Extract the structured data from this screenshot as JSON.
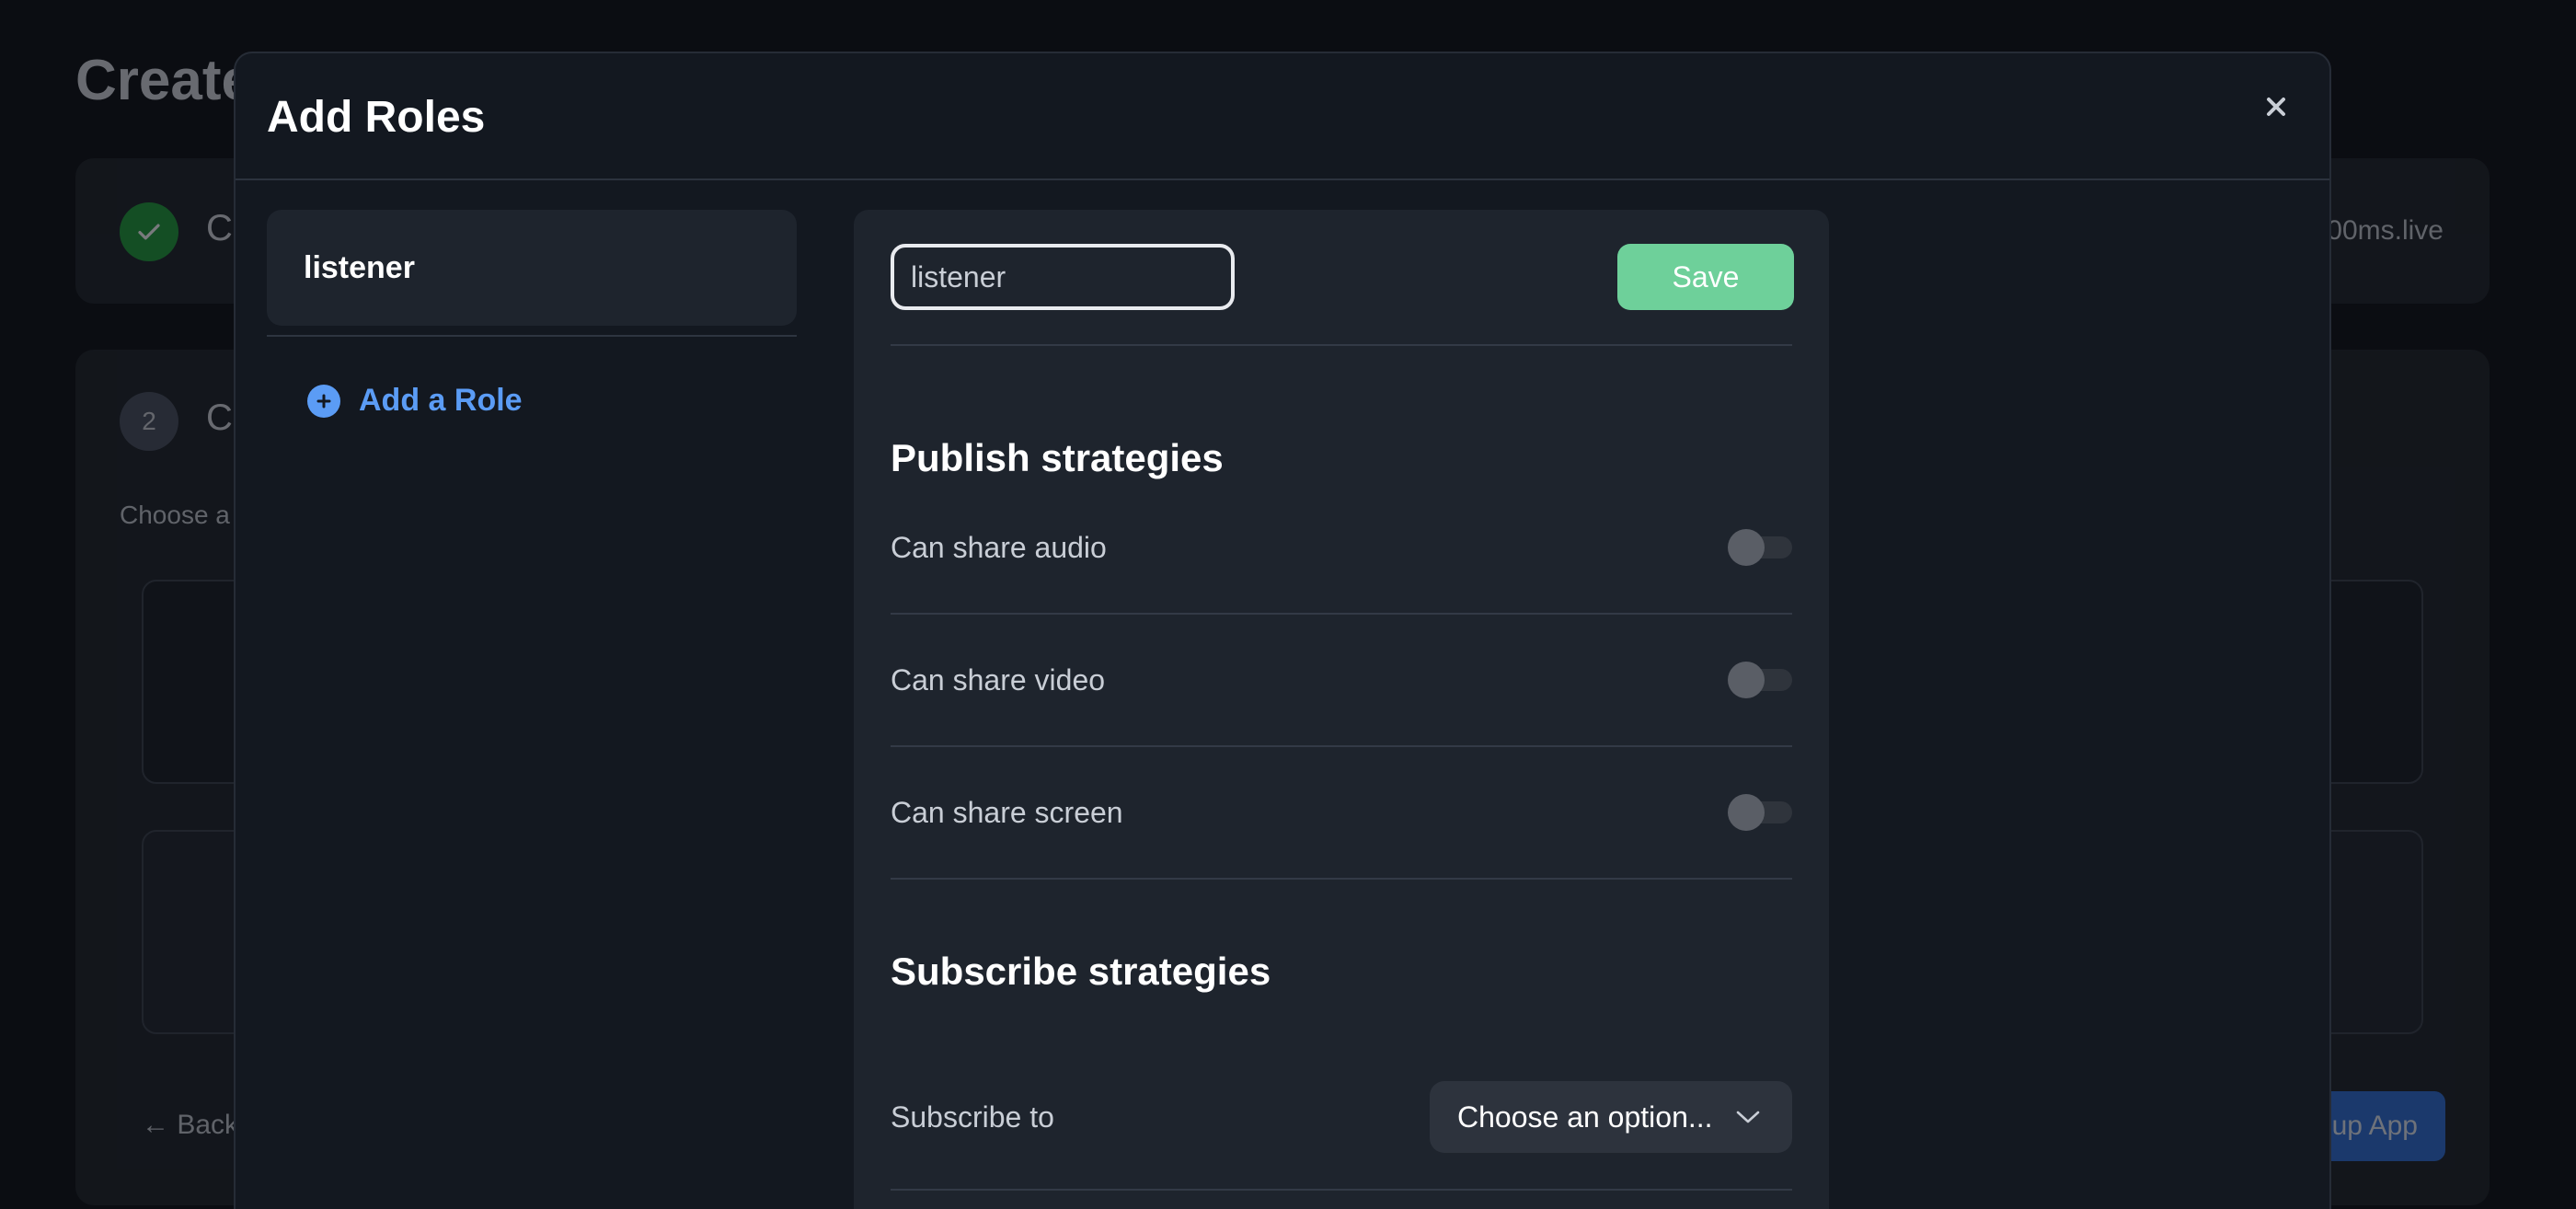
{
  "background": {
    "title": "Create",
    "step1": {
      "label": "C",
      "domain": "00ms.live"
    },
    "step2": {
      "number": "2",
      "label": "C",
      "choose_text": "Choose a"
    },
    "back_label": "Back",
    "setup_label": "up App"
  },
  "modal": {
    "title": "Add Roles",
    "close_icon": "×"
  },
  "roles": {
    "items": [
      {
        "label": "listener"
      }
    ],
    "add_label": "Add a Role"
  },
  "editor": {
    "role_name_value": "listener",
    "save_label": "Save",
    "publish": {
      "title": "Publish strategies",
      "toggles": [
        {
          "label": "Can share audio",
          "enabled": false
        },
        {
          "label": "Can share video",
          "enabled": false
        },
        {
          "label": "Can share screen",
          "enabled": false
        }
      ]
    },
    "subscribe": {
      "title": "Subscribe strategies",
      "subscribe_to_label": "Subscribe to",
      "select_value": "Choose an option..."
    }
  },
  "colors": {
    "accent_blue": "#5b9cf5",
    "save_green": "#6ed09a",
    "success_green": "#1f9d3b"
  }
}
